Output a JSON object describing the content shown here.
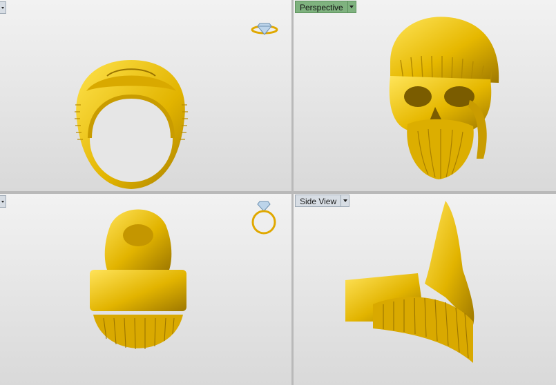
{
  "viewports": {
    "top_left": {
      "label": "",
      "icon": "ring-diamond-icon"
    },
    "top_right": {
      "label": "Perspective"
    },
    "bottom_left": {
      "label": "",
      "icon": "ring-upright-icon"
    },
    "bottom_right": {
      "label": "Side View"
    }
  },
  "colors": {
    "gold": "#f2c200",
    "gold_dark": "#b38a00",
    "active_tab": "#7fb27f"
  }
}
